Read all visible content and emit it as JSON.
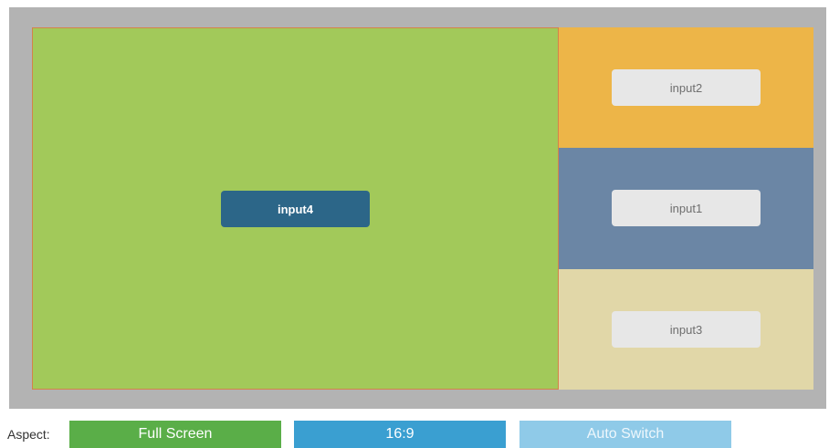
{
  "layout": {
    "zones": {
      "main": {
        "input_label": "input4",
        "color": "#a2c95a"
      },
      "top": {
        "input_label": "input2",
        "color": "#edb548"
      },
      "middle": {
        "input_label": "input1",
        "color": "#6b86a5"
      },
      "bottom": {
        "input_label": "input3",
        "color": "#e1d7a8"
      }
    }
  },
  "aspect": {
    "label": "Aspect:",
    "buttons": {
      "full_screen": {
        "label": "Full Screen",
        "color": "#5aae48"
      },
      "ratio_16_9": {
        "label": "16:9",
        "color": "#3a9fd1"
      },
      "auto_switch": {
        "label": "Auto Switch",
        "color": "#8fcae8"
      }
    }
  }
}
